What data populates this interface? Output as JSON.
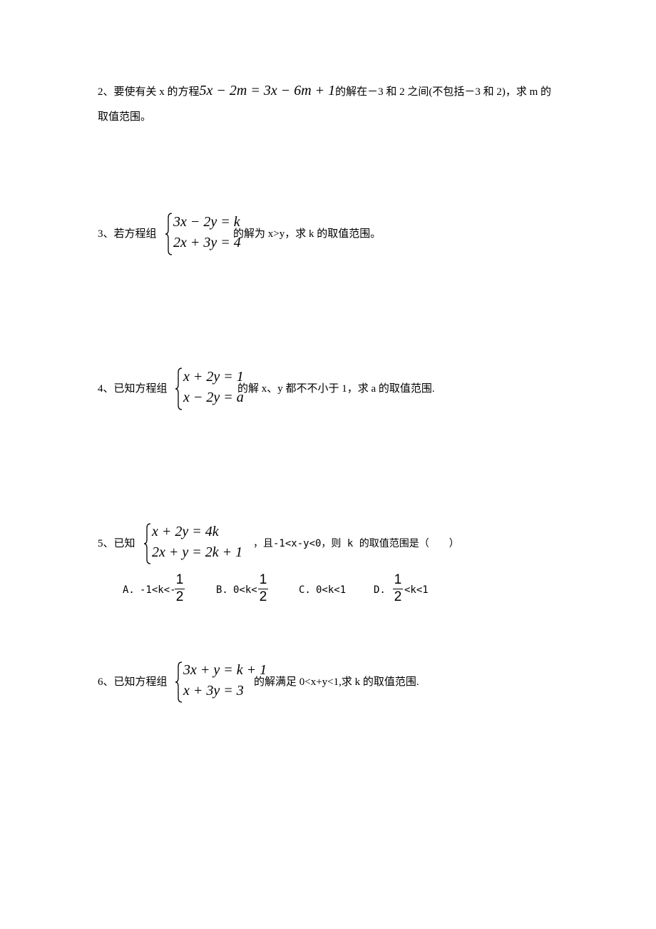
{
  "problems": [
    {
      "number": "2",
      "line1_prefix": "2、要使有关 x 的方程",
      "equation": "5x − 2m = 3x − 6m + 1",
      "line1_suffix": "的解在－3 和 2 之间(不包括－3 和 2)，求 m 的",
      "line2": "取值范围。"
    },
    {
      "number": "3",
      "prefix": "3、若方程组",
      "system": [
        "3x − 2y = k",
        "2x + 3y = 4"
      ],
      "suffix": "的解为 x>y，求 k 的取值范围。"
    },
    {
      "number": "4",
      "prefix": "4、已知方程组",
      "system": [
        "x + 2y = 1",
        "x − 2y = a"
      ],
      "suffix": "的解 x、y 都不不小于 1，求 a 的取值范围."
    },
    {
      "number": "5",
      "prefix": "5、已知",
      "system": [
        "x + 2y = 4k",
        "2x + y = 2k + 1"
      ],
      "suffix": "，且-1<x-y<0，则 k 的取值范围是（　　）",
      "options": [
        {
          "label": "A.",
          "text_before": "-1<k<-",
          "fraction": {
            "num": "1",
            "den": "2"
          },
          "text_after": ""
        },
        {
          "label": "B.",
          "text_before": "0<k<",
          "fraction": {
            "num": "1",
            "den": "2"
          },
          "text_after": ""
        },
        {
          "label": "C.",
          "text_before": "0<k<1",
          "fraction": null,
          "text_after": ""
        },
        {
          "label": "D.",
          "text_before": "",
          "fraction": {
            "num": "1",
            "den": "2"
          },
          "text_after": "<k<1"
        }
      ]
    },
    {
      "number": "6",
      "prefix": "6、已知方程组",
      "system": [
        "3x + y = k + 1",
        "x + 3y = 3"
      ],
      "suffix": "的解满足 0<x+y<1,求 k 的取值范围."
    }
  ]
}
